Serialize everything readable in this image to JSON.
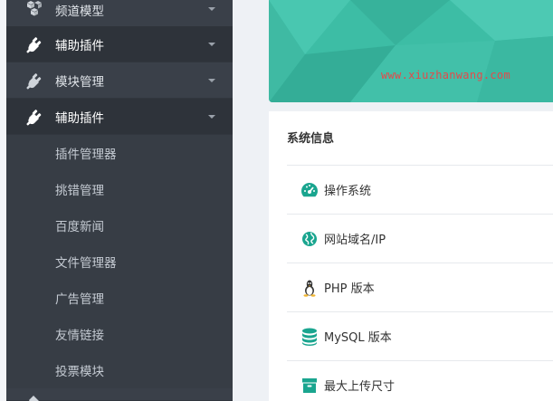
{
  "sidebar": {
    "items": [
      {
        "label": "频道模型",
        "type": "main",
        "icon": "cubes-icon"
      },
      {
        "label": "辅助插件",
        "type": "main",
        "icon": "plug-icon"
      },
      {
        "label": "模块管理",
        "type": "main",
        "icon": "plug-icon"
      },
      {
        "label": "辅助插件",
        "type": "main",
        "icon": "plug-icon"
      },
      {
        "label": "插件管理器",
        "type": "sub"
      },
      {
        "label": "挑错管理",
        "type": "sub"
      },
      {
        "label": "百度新闻",
        "type": "sub"
      },
      {
        "label": "文件管理器",
        "type": "sub"
      },
      {
        "label": "广告管理",
        "type": "sub"
      },
      {
        "label": "友情链接",
        "type": "sub"
      },
      {
        "label": "投票模块",
        "type": "sub"
      }
    ]
  },
  "banner": {
    "watermark": "www.xiuzhanwang.com"
  },
  "system_info": {
    "title": "系统信息",
    "rows": [
      {
        "label": "操作系统",
        "icon": "dashboard-icon"
      },
      {
        "label": "网站域名/IP",
        "icon": "globe-icon"
      },
      {
        "label": "PHP 版本",
        "icon": "linux-icon"
      },
      {
        "label": "MySQL 版本",
        "icon": "database-icon"
      },
      {
        "label": "最大上传尺寸",
        "icon": "archive-icon"
      }
    ]
  },
  "colors": {
    "sidebar_bg": "#2f353d",
    "accent": "#3dbda5",
    "icon_teal": "#1aa58f"
  }
}
